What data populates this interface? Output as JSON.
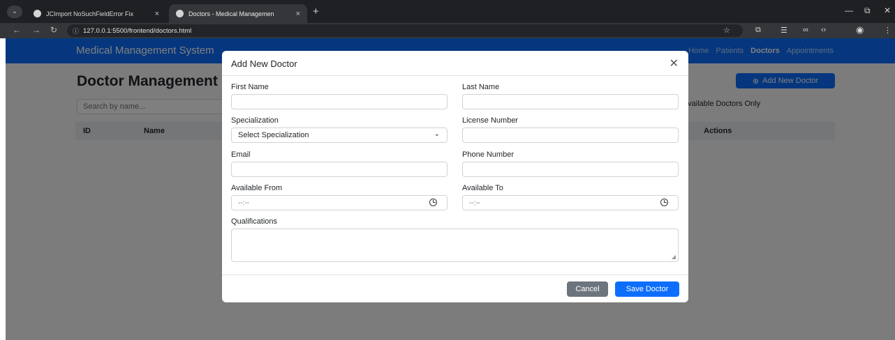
{
  "browser": {
    "tabs": [
      {
        "title": "JCImport NoSuchFieldError Fix",
        "close": "×"
      },
      {
        "title": "Doctors - Medical Managemen",
        "close": "×"
      }
    ],
    "new_tab": "+",
    "url": "127.0.0.1:5500/frontend/doctors.html",
    "window_controls": {
      "minimize": "—",
      "restore": "⧉",
      "close": "✕"
    },
    "icons": {
      "back": "←",
      "forward": "→",
      "reload": "↻",
      "bookmark": "☆",
      "extensions": "⧉",
      "reading": "☰",
      "link": "∞",
      "code": "‹›",
      "profile": "◉",
      "menu": "⋮"
    }
  },
  "page": {
    "brand": "Medical Management System",
    "nav": [
      "Home",
      "Patients",
      "Doctors",
      "Appointments"
    ],
    "nav_active": "Doctors",
    "title": "Doctor Management",
    "add_button": "Add New Doctor",
    "add_icon": "⊕",
    "search_placeholder": "Search by name...",
    "filter_label": "Available Doctors Only",
    "table_headers": {
      "id": "ID",
      "name": "Name",
      "actions": "Actions"
    }
  },
  "modal": {
    "title": "Add New Doctor",
    "close_icon": "✕",
    "fields": {
      "first_name": {
        "label": "First Name",
        "value": ""
      },
      "last_name": {
        "label": "Last Name",
        "value": ""
      },
      "specialization": {
        "label": "Specialization",
        "value": "Select Specialization"
      },
      "license_number": {
        "label": "License Number",
        "value": ""
      },
      "email": {
        "label": "Email",
        "value": ""
      },
      "phone_number": {
        "label": "Phone Number",
        "value": ""
      },
      "available_from": {
        "label": "Available From",
        "value": "--:--"
      },
      "available_to": {
        "label": "Available To",
        "value": "--:--"
      },
      "qualifications": {
        "label": "Qualifications",
        "value": ""
      }
    },
    "cancel_label": "Cancel",
    "save_label": "Save Doctor"
  },
  "colors": {
    "primary": "#0d6efd",
    "secondary": "#6c757d",
    "chrome_dark": "#1f2023"
  }
}
